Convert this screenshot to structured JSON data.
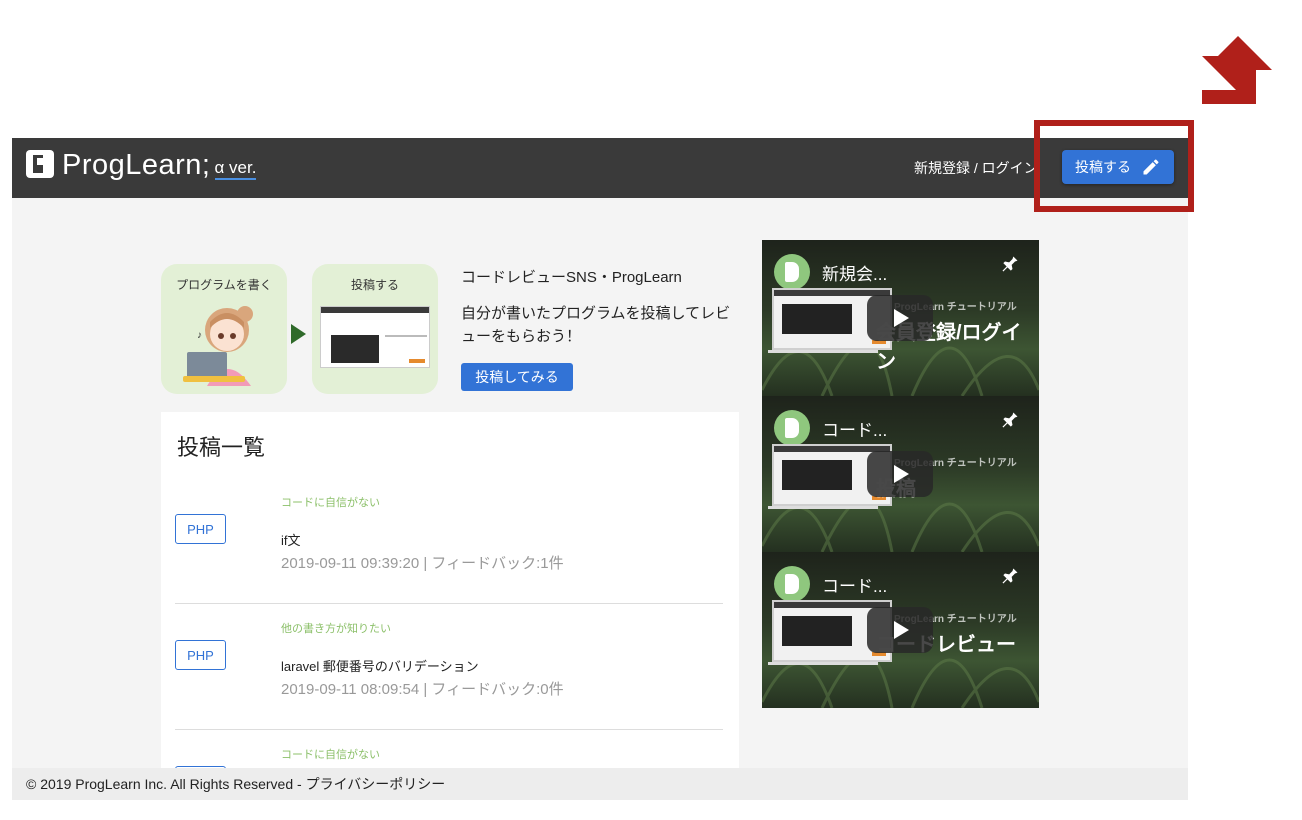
{
  "header": {
    "logo_text": "ProgLearn;",
    "logo_version": "α ver.",
    "auth_links": "新規登録 / ログイン",
    "post_button_label": "投稿する"
  },
  "intro": {
    "card1_title": "プログラムを書く",
    "card2_title": "投稿する",
    "title": "コードレビューSNS・ProgLearn",
    "description": "自分が書いたプログラムを投稿してレビューをもらおう！",
    "try_button_label": "投稿してみる"
  },
  "post_list": {
    "heading": "投稿一覧",
    "items": [
      {
        "lang": "PHP",
        "category": "コードに自信がない",
        "title": "if文",
        "meta": "2019-09-11 09:39:20 | フィードバック:1件"
      },
      {
        "lang": "PHP",
        "category": "他の書き方が知りたい",
        "title": "laravel 郵便番号のバリデーション",
        "meta": "2019-09-11 08:09:54 | フィードバック:0件"
      },
      {
        "lang": "",
        "category": "コードに自信がない",
        "title": "",
        "meta": ""
      }
    ]
  },
  "videos": [
    {
      "title": "新規会...",
      "subtitle": "ProgLearn チュートリアル",
      "overlay": "会員登録/ログイン"
    },
    {
      "title": "コード...",
      "subtitle": "ProgLearn チュートリアル",
      "overlay": "投稿"
    },
    {
      "title": "コード...",
      "subtitle": "ProgLearn チュートリアル",
      "overlay": "コードレビュー"
    }
  ],
  "footer": {
    "text": "© 2019 ProgLearn Inc. All Rights Reserved - プライバシーポリシー"
  },
  "colors": {
    "header_bg": "#3a3a3a",
    "accent_blue": "#3273d6",
    "highlight_red": "#b0201a",
    "category_green": "#8cc06a",
    "card_green": "#e3f0d6"
  },
  "icons": [
    "pencil-icon",
    "pin-icon",
    "play-icon",
    "callout-arrow-icon"
  ]
}
